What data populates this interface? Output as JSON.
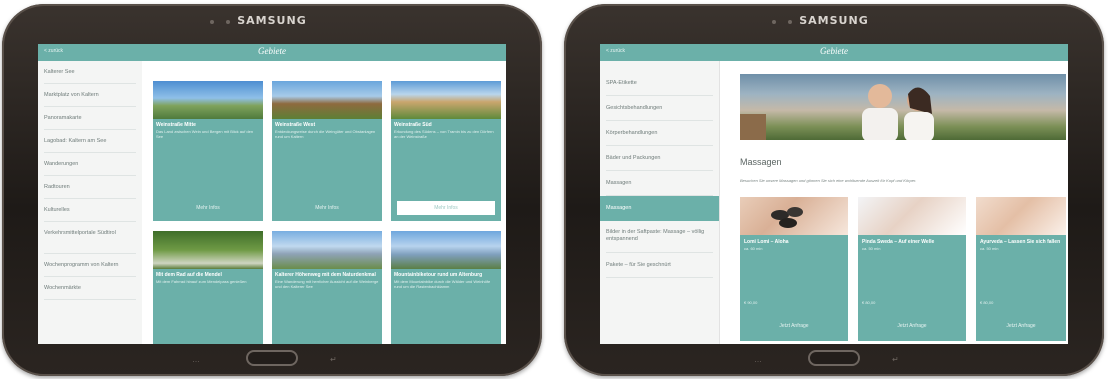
{
  "device": {
    "brand": "SAMSUNG",
    "menu_key": "…",
    "back_key": "↵"
  },
  "left_screen": {
    "topbar": {
      "back": "< zurück",
      "logo": "Gebiete"
    },
    "sidebar": [
      "Kalterer See",
      "Marktplatz von Kaltern",
      "Panoramakarte",
      "Lagobad: Kaltern am See",
      "Wanderungen",
      "Radtouren",
      "Kulturelles",
      "Verkehrsmittelportale Südtirol",
      "Wochenprogramm von Kaltern",
      "Wochenmärkte"
    ],
    "cards": [
      {
        "title": "Weinstraße Mitte",
        "desc": "Das Land zwischen Wein und Bergen mit Blick auf den See",
        "more": "Mehr Infos"
      },
      {
        "title": "Weinstraße West",
        "desc": "Entdeckungsreise durch die Weingüter und Obstanlagen rund um Kaltern",
        "more": "Mehr Infos"
      },
      {
        "title": "Weinstraße Süd",
        "desc": "Erkundung des Südens – von Tramin bis zu den Dörfern an der Weinstraße",
        "more": "Mehr Infos"
      },
      {
        "title": "Mit dem Rad auf die Mendel",
        "desc": "Mit dem Fahrrad hinauf zum Mendelpass genießen",
        "more": ""
      },
      {
        "title": "Kalterer Höhenweg mit dem Naturdenkmal",
        "desc": "Eine Wanderung mit herrlicher Aussicht auf die Weinberge und den Kalterer See",
        "more": ""
      },
      {
        "title": "Mountainbiketour rund um Altenburg",
        "desc": "Mit dem Mountainbike durch die Wälder und Weinhöfe rund um die Rastenbachklamm",
        "more": ""
      }
    ]
  },
  "right_screen": {
    "topbar": {
      "back": "< zurück",
      "logo": "Gebiete"
    },
    "sidebar": [
      "SPA-Etikette",
      "Gesichtsbehandlungen",
      "Körperbehandlungen",
      "Bäder und Packungen",
      "Massagen",
      "Bilder in der Saftpaste: Massage – völlig entspannend",
      "Pakete – für Sie geschnürt"
    ],
    "active_item_index": 4,
    "page_title": "Massagen",
    "intro": "Besuchen Sie unsere Massagen und gönnen Sie sich eine wohltuende Auszeit für Kopf und Körper.",
    "cards": [
      {
        "title": "Lomi Lomi – Aloha",
        "duration": "ca. 60 min",
        "price": "€ 90,00",
        "request": "Jetzt Anfrage"
      },
      {
        "title": "Pinda Sweda – Auf einer Welle",
        "duration": "ca. 50 min",
        "price": "€ 80,00",
        "request": "Jetzt Anfrage"
      },
      {
        "title": "Ayurveda – Lassen Sie sich fallen",
        "duration": "ca. 50 min",
        "price": "€ 80,00",
        "request": "Jetzt Anfrage"
      }
    ]
  },
  "colors": {
    "accent": "#6bb0a9",
    "bezel": "#2a2420",
    "text": "#6f7c7a"
  },
  "icons": {
    "back": "chevron-left-icon",
    "home": "home-button-icon"
  }
}
